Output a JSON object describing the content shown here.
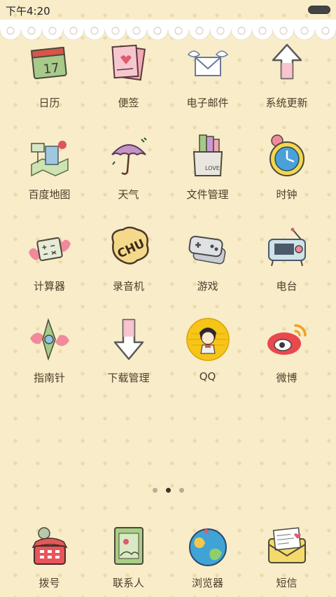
{
  "status": {
    "time": "下午4:20"
  },
  "apps": [
    {
      "label": "日历",
      "icon": "calendar-icon"
    },
    {
      "label": "便签",
      "icon": "notes-icon"
    },
    {
      "label": "电子邮件",
      "icon": "email-icon"
    },
    {
      "label": "系统更新",
      "icon": "update-arrow-icon"
    },
    {
      "label": "百度地图",
      "icon": "map-icon"
    },
    {
      "label": "天气",
      "icon": "umbrella-icon"
    },
    {
      "label": "文件管理",
      "icon": "folder-icon"
    },
    {
      "label": "时钟",
      "icon": "clock-icon"
    },
    {
      "label": "计算器",
      "icon": "calculator-icon"
    },
    {
      "label": "录音机",
      "icon": "recorder-icon"
    },
    {
      "label": "游戏",
      "icon": "gamepad-icon"
    },
    {
      "label": "电台",
      "icon": "radio-icon"
    },
    {
      "label": "指南针",
      "icon": "compass-icon"
    },
    {
      "label": "下载管理",
      "icon": "download-icon"
    },
    {
      "label": "QQ",
      "icon": "qq-icon"
    },
    {
      "label": "微博",
      "icon": "weibo-icon"
    }
  ],
  "pages": {
    "total": 3,
    "current": 2
  },
  "dock": [
    {
      "label": "拨号",
      "icon": "phone-icon"
    },
    {
      "label": "联系人",
      "icon": "contacts-icon"
    },
    {
      "label": "浏览器",
      "icon": "globe-icon"
    },
    {
      "label": "短信",
      "icon": "envelope-icon"
    }
  ],
  "icon_badges": {
    "calendar": "17",
    "recorder": "CHU",
    "folder": "LOVE"
  }
}
